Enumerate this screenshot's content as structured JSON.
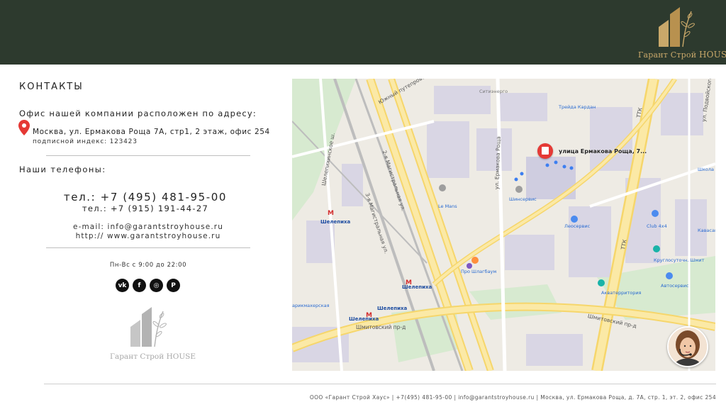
{
  "logo": {
    "text_regular": "Гарант Строй ",
    "text_bold": "HOUSE"
  },
  "contacts": {
    "title": "КОНТАКТЫ",
    "office_heading": "Офис нашей компании расположен по адресу:",
    "address": "Москва, ул. Ермакова Роща 7А, стр1, 2 этаж, офис 254",
    "postal": "подписной индекс: 123423",
    "phones_heading": "Наши телефоны:",
    "phone1": "тел.: +7 (495) 481-95-00",
    "phone2": "тел.: +7 (915) 191-44-27",
    "email": "e-mail: info@garantstroyhouse.ru",
    "site": "http:// www.garantstroyhouse.ru",
    "hours": "Пн-Вс с 9:00 до 22:00"
  },
  "social": [
    {
      "icon": "vk-icon",
      "glyph": "vk"
    },
    {
      "icon": "facebook-icon",
      "glyph": "f"
    },
    {
      "icon": "instagram-icon",
      "glyph": "◎"
    },
    {
      "icon": "pinterest-icon",
      "glyph": "P"
    }
  ],
  "map": {
    "pin_label": "улица Ермакова Роща, 7...",
    "metro": "Шелепиха",
    "roads": {
      "mag_3": "3-я Магистральная ул.",
      "mag_2": "2-я Магистральная ул.",
      "ermakova": "ул. Ермакова Роща",
      "shmit": "Шмитовский пр-д",
      "ttk": "ТТК",
      "shelep": "Шелепихинское ш.",
      "podvoisk": "ул. Подвойского",
      "yuzhny": "Южный путепровод"
    },
    "pois": {
      "treyda": "Трейда Кардан",
      "lemans": "Le Mans",
      "shinservice": "Шинсервис",
      "leoservis": "Леосервис",
      "club": "Club 4x4",
      "kavasaki": "Кавасаки",
      "kruglo": "Круглосуточн. Шмит",
      "autoservice": "Автосервис",
      "akvaterr": "Акватерритория",
      "proshlagbaum": "Про Шлагбаум",
      "shkola": "Школа №",
      "sitienergo": "Ситиэнерго",
      "parikmakher": "арикмахерская"
    }
  },
  "footer": "ООО «Гарант Строй Хаус» | +7(495) 481-95-00 | info@garantstroyhouse.ru | Москва, ул. Ермакова Роща, д. 7А, стр. 1, эт. 2, офис 254",
  "colors": {
    "header": "#2d3a2e",
    "gold": "#c9a86a",
    "pin": "#e53935"
  }
}
